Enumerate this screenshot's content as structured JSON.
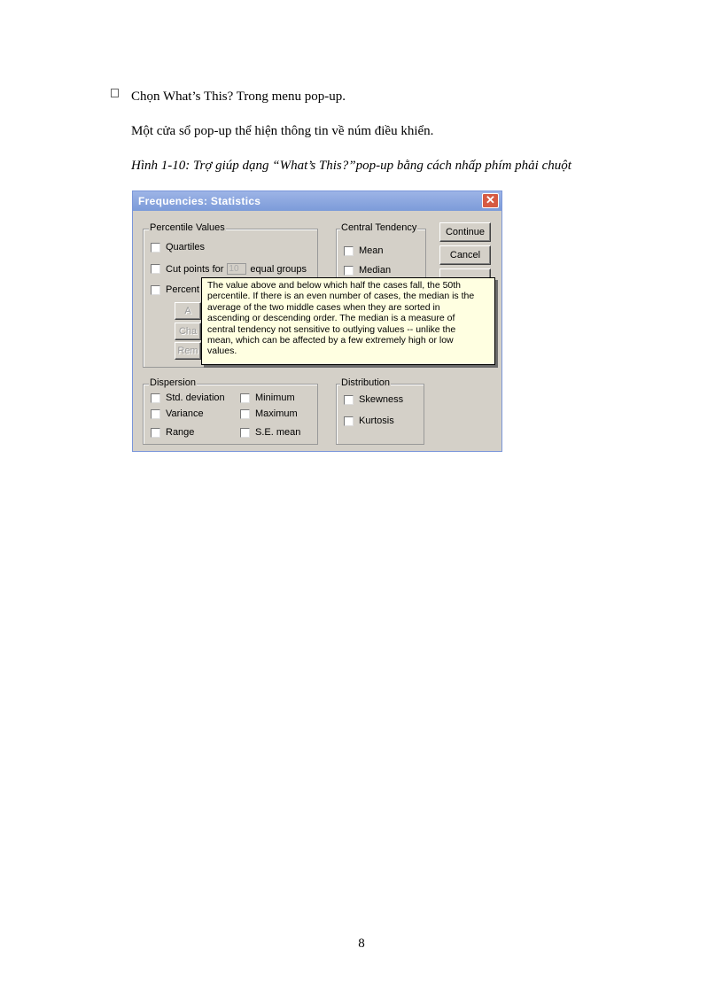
{
  "document": {
    "bullet_text": "Chọn What’s This? Trong menu pop-up.",
    "paragraph": "Một cửa sổ pop-up thể hiện thông tin về núm điều khiển.",
    "caption": "Hình 1-10: Trợ giúp dạng “What’s This?”pop-up  bằng cách nhấp phím phải chuột",
    "page_number": "8"
  },
  "dialog": {
    "title": "Frequencies: Statistics",
    "close_glyph": "✕",
    "percentile_group": {
      "legend": "Percentile Values",
      "quartiles": "Quartiles",
      "cut_points_prefix": "Cut points for",
      "cut_points_value": "10",
      "cut_points_suffix": "equal groups",
      "percentiles_partial": "Percent",
      "add_partial": "A",
      "change_partial": "Cha",
      "remove_partial": "Rem"
    },
    "central_group": {
      "legend": "Central Tendency",
      "mean": "Mean",
      "median": "Median"
    },
    "buttons": {
      "continue": "Continue",
      "cancel": "Cancel"
    },
    "dispersion_group": {
      "legend": "Dispersion",
      "std_deviation": "Std. deviation",
      "variance": "Variance",
      "range": "Range",
      "minimum": "Minimum",
      "maximum": "Maximum",
      "se_mean": "S.E. mean"
    },
    "distribution_group": {
      "legend": "Distribution",
      "skewness": "Skewness",
      "kurtosis": "Kurtosis"
    },
    "tooltip_lines": [
      "The value above and below which half the cases fall, the 50th",
      "percentile. If there is an even number of cases, the median is the",
      "average of the two middle cases when they are sorted in",
      "ascending or descending order. The median is a measure of",
      "central tendency not sensitive to outlying values -- unlike the",
      "mean, which can be affected by a few extremely high or low",
      "values."
    ]
  }
}
